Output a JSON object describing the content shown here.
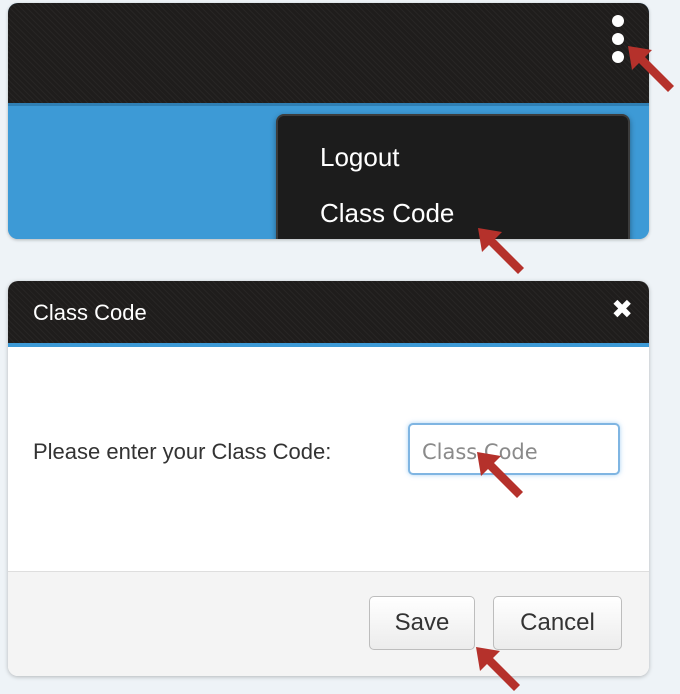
{
  "menu": {
    "items": [
      "Logout",
      "Class Code"
    ]
  },
  "dialog": {
    "title": "Class Code",
    "close_symbol": "✖",
    "prompt": "Please enter your Class Code:",
    "input_placeholder": "Class Code",
    "input_value": "",
    "save_label": "Save",
    "cancel_label": "Cancel"
  },
  "colors": {
    "header_bg": "#1f1d1c",
    "accent_blue": "#3d9ad6",
    "annotation_arrow": "#b5312b"
  },
  "icons": {
    "menu": "kebab-menu-icon",
    "close": "close-icon",
    "annotation": "arrow-pointer-icon"
  }
}
